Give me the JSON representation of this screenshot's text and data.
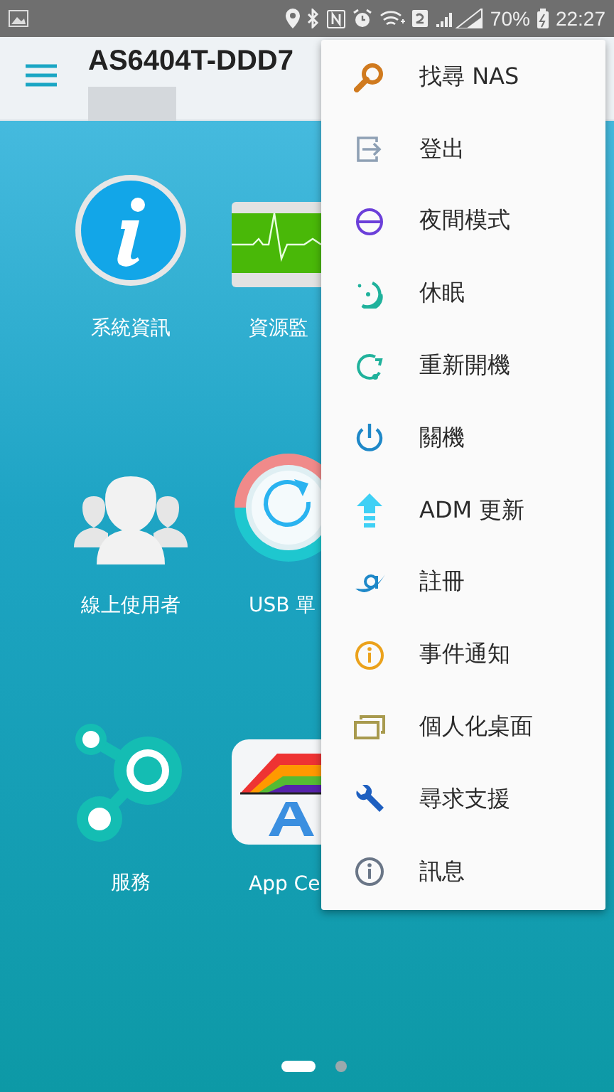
{
  "status_bar": {
    "battery": "70%",
    "time": "22:27"
  },
  "app_bar": {
    "title": "AS6404T-DDD7"
  },
  "apps": [
    {
      "label": "系統資訊",
      "kind": "info"
    },
    {
      "label": "資源監",
      "kind": "monitor"
    },
    {
      "label": "線上使用者",
      "kind": "users"
    },
    {
      "label": "USB 單",
      "kind": "usb"
    },
    {
      "label": "服務",
      "kind": "services"
    },
    {
      "label": "App Ce",
      "kind": "appcenter"
    }
  ],
  "menu": {
    "items": [
      {
        "label": "找尋 NAS",
        "kind": "search"
      },
      {
        "label": "登出",
        "kind": "logout"
      },
      {
        "label": "夜間模式",
        "kind": "night"
      },
      {
        "label": "休眠",
        "kind": "sleep"
      },
      {
        "label": "重新開機",
        "kind": "restart"
      },
      {
        "label": "關機",
        "kind": "power"
      },
      {
        "label": "ADM 更新",
        "kind": "update"
      },
      {
        "label": "註冊",
        "kind": "register"
      },
      {
        "label": "事件通知",
        "kind": "notify"
      },
      {
        "label": "個人化桌面",
        "kind": "desktop"
      },
      {
        "label": "尋求支援",
        "kind": "support"
      },
      {
        "label": "訊息",
        "kind": "about"
      }
    ]
  },
  "pager": [
    {
      "selected": true
    },
    {
      "selected": false
    }
  ]
}
